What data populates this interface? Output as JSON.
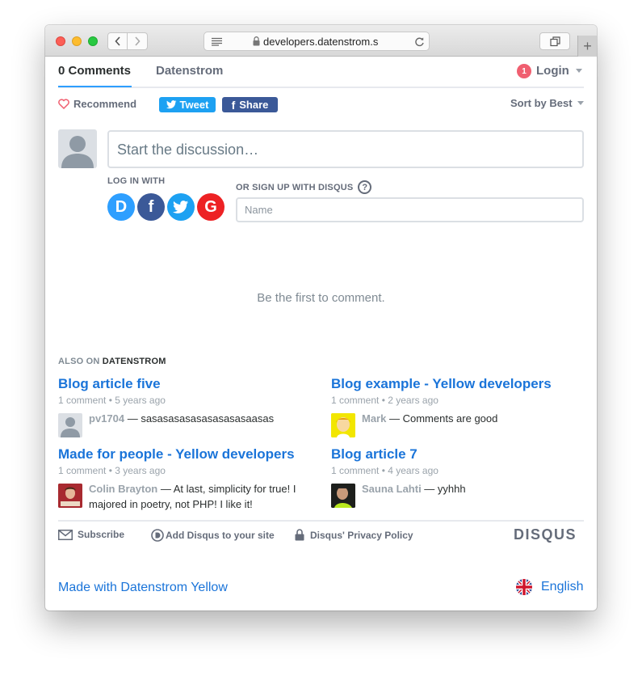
{
  "browser": {
    "url": "developers.datenstrom.se",
    "new_tab_label": "+"
  },
  "header": {
    "comments_tab": "0 Comments",
    "site_tab": "Datenstrom",
    "notification_count": "1",
    "login_label": "Login"
  },
  "actions": {
    "recommend": "Recommend",
    "tweet": "Tweet",
    "share": "Share",
    "sort": "Sort by Best"
  },
  "composer": {
    "placeholder": "Start the discussion…",
    "login_with": "LOG IN WITH",
    "signup_with": "OR SIGN UP WITH DISQUS",
    "help": "?",
    "name_placeholder": "Name",
    "providers": [
      {
        "name": "disqus",
        "letter": "D",
        "color": "#2e9fff"
      },
      {
        "name": "facebook",
        "letter": "f",
        "color": "#3b5998"
      },
      {
        "name": "twitter",
        "letter": "",
        "color": "#1da1f2"
      },
      {
        "name": "google",
        "letter": "G",
        "color": "#ed2224"
      }
    ]
  },
  "empty_message": "Be the first to comment.",
  "also_on": {
    "prefix": "ALSO ON",
    "site": "DATENSTROM",
    "articles": [
      {
        "title": "Blog article five",
        "comments": "1 comment",
        "age": "5 years ago",
        "author": "pv1704",
        "text": "sasasasasasasasasasaasas",
        "avatar": "default"
      },
      {
        "title": "Blog example - Yellow developers",
        "comments": "1 comment",
        "age": "2 years ago",
        "author": "Mark",
        "text": "Comments are good",
        "avatar": "yellow"
      },
      {
        "title": "Made for people - Yellow developers",
        "comments": "1 comment",
        "age": "3 years ago",
        "author": "Colin Brayton",
        "text": "At last, simplicity for true! I majored in poetry, not PHP! I like it!",
        "avatar": "red"
      },
      {
        "title": "Blog article 7",
        "comments": "1 comment",
        "age": "4 years ago",
        "author": "Sauna Lahti",
        "text": "yyhhh",
        "avatar": "dark"
      }
    ]
  },
  "footer": {
    "subscribe": "Subscribe",
    "add_disqus": "Add Disqus to your site",
    "privacy": "Disqus' Privacy Policy",
    "logo": "DISQUS"
  },
  "page_footer": {
    "made_with": "Made with Datenstrom Yellow",
    "language": "English"
  },
  "colors": {
    "accent": "#2e9fff",
    "link": "#1a74d9",
    "notification": "#f05f70"
  }
}
